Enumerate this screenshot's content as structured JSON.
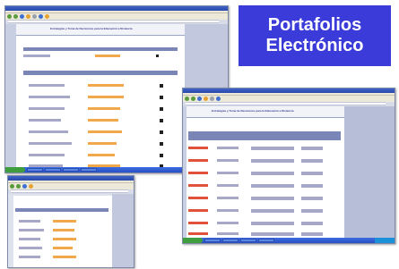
{
  "title": {
    "line1": "Portafolios",
    "line2": "Electrónico"
  },
  "windows": {
    "main_header": "Estrategias y Toma de Decisiones para la Educación a Distancia",
    "right_header": "Estrategias y Toma de Decisiones para la Educación a Distancia"
  },
  "colors": {
    "title_bg": "#3b3bd9",
    "title_text": "#ffffff",
    "link_orange": "#f0a84a",
    "link_red": "#e0523a",
    "table_header": "#7a86b8",
    "taskbar": "#2750c4"
  }
}
